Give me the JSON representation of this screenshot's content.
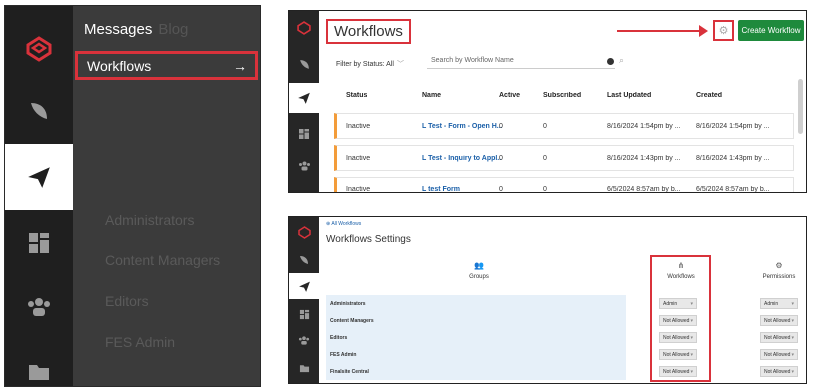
{
  "panel_a": {
    "menu_title": "Messages",
    "menu_title_ghost": "Blog",
    "selected_item": "Workflows",
    "selected_arrow": "→",
    "faded_items": [
      "Administrators",
      "Content Managers",
      "Editors",
      "FES Admin"
    ],
    "rail_icons": [
      "logo-icon",
      "feather-icon",
      "send-icon",
      "dashboard-icon",
      "groups-icon",
      "folder-icon"
    ],
    "accent": "#d9323b"
  },
  "panel_b": {
    "title": "Workflows",
    "create_button": "Create Workflow",
    "filter_label": "Filter by Status: All",
    "search_placeholder": "Search by Workflow Name",
    "columns": [
      "Status",
      "Name",
      "Active",
      "Subscribed",
      "Last Updated",
      "Created"
    ],
    "rows": [
      {
        "status": "Inactive",
        "name": "L Test - Form - Open H...",
        "active": "0",
        "subscribed": "0",
        "updated": "8/16/2024 1:54pm by ...",
        "created": "8/16/2024 1:54pm by ..."
      },
      {
        "status": "Inactive",
        "name": "L Test - Inquiry to Appl...",
        "active": "0",
        "subscribed": "0",
        "updated": "8/16/2024 1:43pm by ...",
        "created": "8/16/2024 1:43pm by ..."
      },
      {
        "status": "Inactive",
        "name": "L test Form",
        "active": "0",
        "subscribed": "0",
        "updated": "6/5/2024 8:57am by b...",
        "created": "6/5/2024 8:57am by b..."
      }
    ],
    "create_color": "#1e8a3c",
    "row_accent": "#f39c3a"
  },
  "panel_c": {
    "breadcrumb": "All Workflows",
    "title": "Workflows Settings",
    "col_groups": "Groups",
    "col_workflows": "Workflows",
    "col_permissions": "Permissions",
    "rows": [
      {
        "group": "Administrators",
        "workflows": "Admin",
        "permissions": "Admin"
      },
      {
        "group": "Content Managers",
        "workflows": "Not Allowed",
        "permissions": "Not Allowed"
      },
      {
        "group": "Editors",
        "workflows": "Not Allowed",
        "permissions": "Not Allowed"
      },
      {
        "group": "FES Admin",
        "workflows": "Not Allowed",
        "permissions": "Not Allowed"
      },
      {
        "group": "Finalsite Central",
        "workflows": "Not Allowed",
        "permissions": "Not Allowed"
      }
    ],
    "row_bg": "#e6f0f9"
  }
}
